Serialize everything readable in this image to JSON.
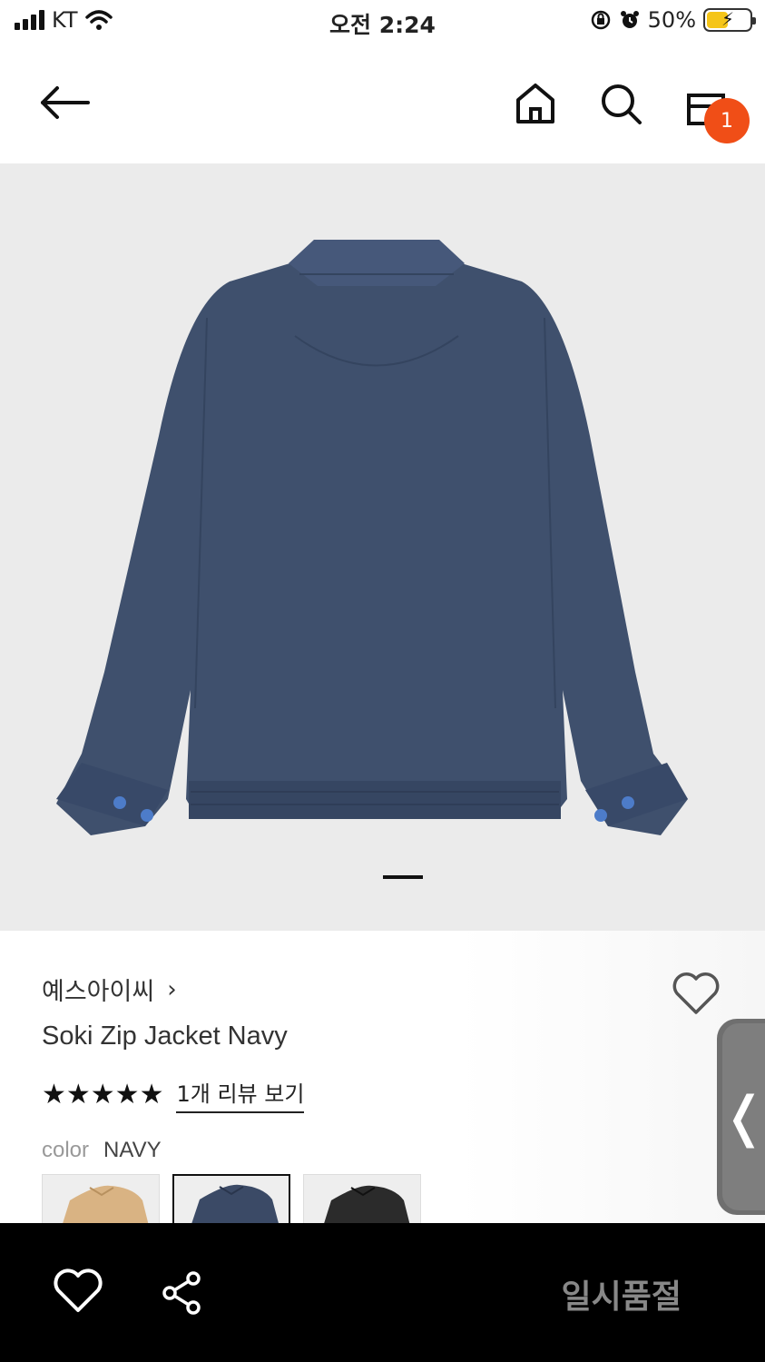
{
  "status_bar": {
    "carrier": "KT",
    "time": "오전 2:24",
    "battery": "50%"
  },
  "header": {
    "cart_count": "1"
  },
  "gallery": {
    "image_alt": "Soki Zip Jacket Navy back view",
    "page_count": 2,
    "active_page": 2
  },
  "product": {
    "brand": "예스아이씨",
    "brand_chevron": "›",
    "name": "Soki Zip Jacket Navy",
    "stars": "★★★★★",
    "review_link": "1개 리뷰 보기",
    "color_label": "color",
    "color_value": "NAVY",
    "swatches": [
      {
        "name": "beige",
        "color": "#d9b383"
      },
      {
        "name": "navy",
        "color": "#3b4a66"
      },
      {
        "name": "black",
        "color": "#2b2b2b"
      }
    ]
  },
  "side_tab": {
    "glyph": "❬"
  },
  "bottom_bar": {
    "status": "일시품절"
  },
  "colors": {
    "accent_badge": "#f04e17",
    "jacket_navy": "#3f506d"
  }
}
